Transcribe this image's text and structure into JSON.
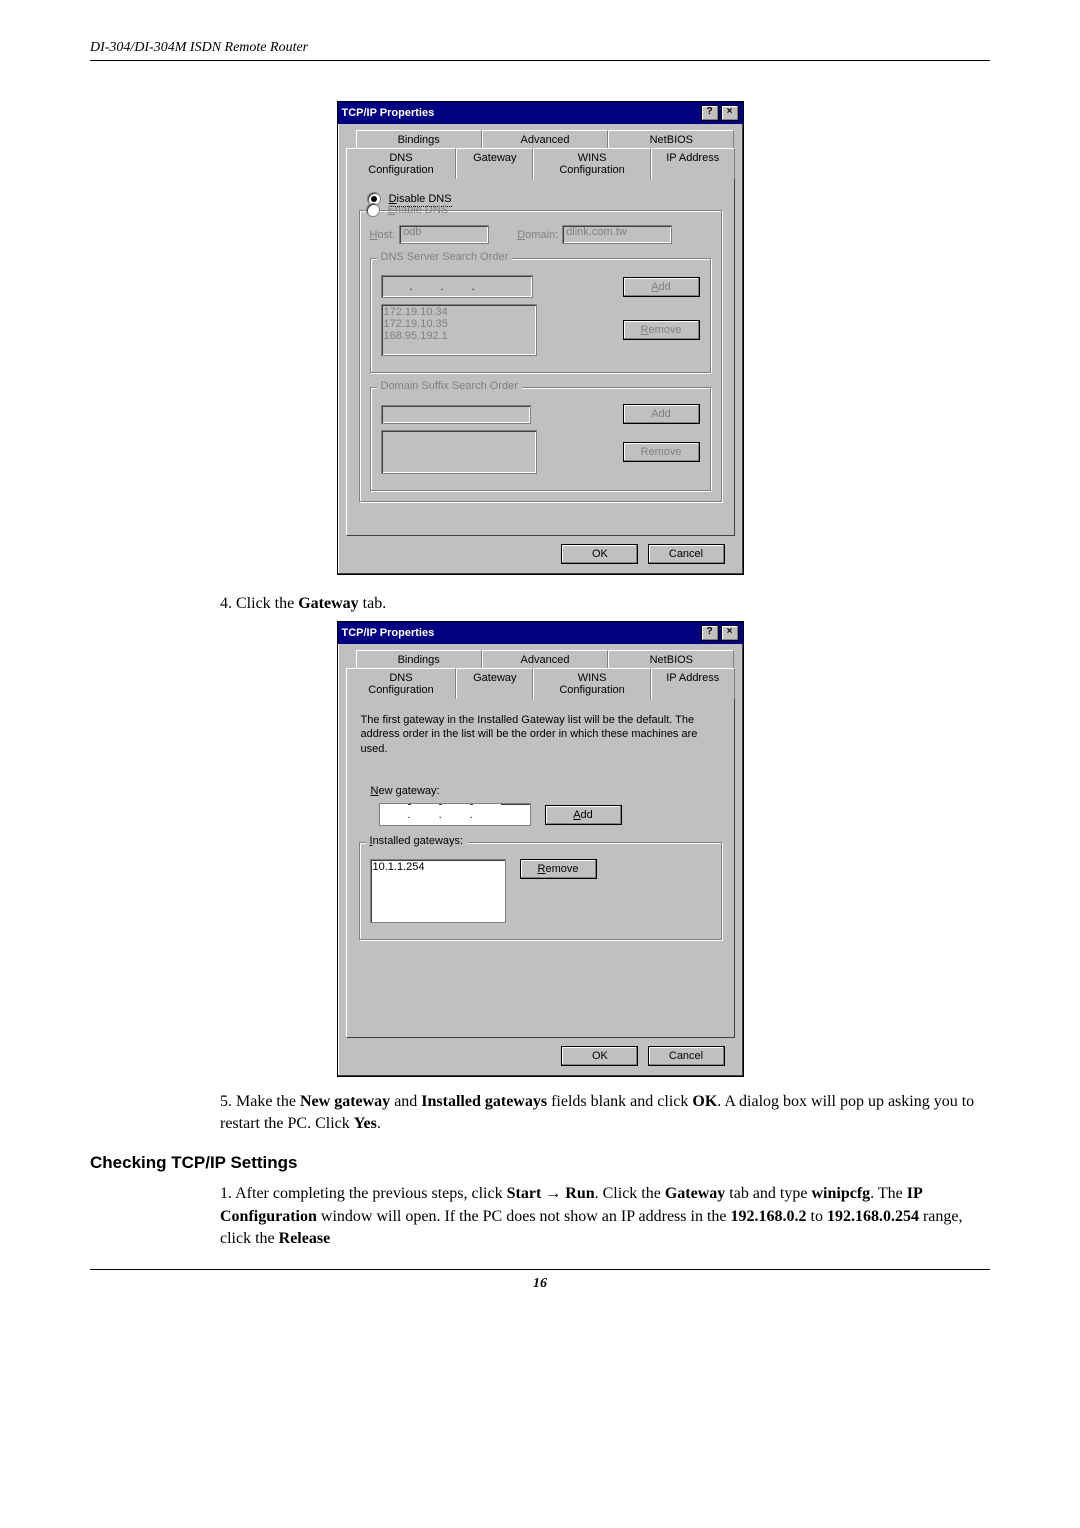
{
  "header": "DI-304/DI-304M ISDN Remote Router",
  "page_number": "16",
  "dialog1": {
    "title": "TCP/IP Properties",
    "tabs_back": {
      "bindings": "Bindings",
      "advanced": "Advanced",
      "netbios": "NetBIOS"
    },
    "tabs_front": {
      "dnsconf": "DNS Configuration",
      "gateway": "Gateway",
      "winsc": "WINS Configuration",
      "ipaddr": "IP Address"
    },
    "disable_dns": {
      "pre": "D",
      "post": "isable DNS"
    },
    "enable_dns": {
      "pre": "E",
      "post": "nable DNS"
    },
    "host_label": {
      "pre": "H",
      "post": "ost:"
    },
    "host_value": "odb",
    "domain_label": {
      "pre": "D",
      "post": "omain:"
    },
    "domain_value": "dlink.com.tw",
    "dns_search_label": "DNS Server Search Order",
    "dns_list": [
      "172.19.10.34",
      "172.19.10.35",
      "168.95.192.1"
    ],
    "suffix_label": "Domain Suffix Search Order",
    "btn_add": {
      "pre": "A",
      "post": "dd"
    },
    "btn_remove": {
      "pre": "R",
      "post": "emove"
    },
    "btn_ok": "OK",
    "btn_cancel": "Cancel"
  },
  "step4": {
    "pre": "4. Click the ",
    "bold": "Gateway",
    "post": " tab."
  },
  "dialog2": {
    "title": "TCP/IP Properties",
    "instructions": "The first gateway in the Installed Gateway list will be the default. The address order in the list will be the order in which these machines are used.",
    "new_gateway_label": {
      "pre": "N",
      "post": "ew gateway:"
    },
    "installed_label": {
      "pre": "I",
      "post": "nstalled gateways:"
    },
    "installed_value": "10.1.1.254",
    "btn_add": {
      "pre": "A",
      "post": "dd"
    },
    "btn_remove": {
      "pre": "R",
      "post": "emove"
    },
    "btn_ok": "OK",
    "btn_cancel": "Cancel"
  },
  "step5": {
    "p1a": "5. Make the ",
    "b1": "New gateway",
    "p1b": " and ",
    "b2": "Installed gateways",
    "p1c": " fields blank and click ",
    "b3": "OK",
    "p1d": ". A dialog box will pop up asking you to restart the PC. Click ",
    "b4": "Yes",
    "p1e": "."
  },
  "heading_check": "Checking TCP/IP Settings",
  "step_check1": {
    "a": "1. After completing the previous steps, click ",
    "b1": "Start",
    "arrow": " → ",
    "b2": "Run",
    "c": ". Click the ",
    "b3": "Gateway",
    "d": " tab and type ",
    "b4": "winipcfg",
    "e": ". The ",
    "b5": "IP Configuration",
    "f": " window will open. If the PC does not show an IP address in the ",
    "b6": "192.168.0.2",
    "g": " to ",
    "b7": "192.168.0.254",
    "h": " range, click the ",
    "b8": "Release"
  }
}
